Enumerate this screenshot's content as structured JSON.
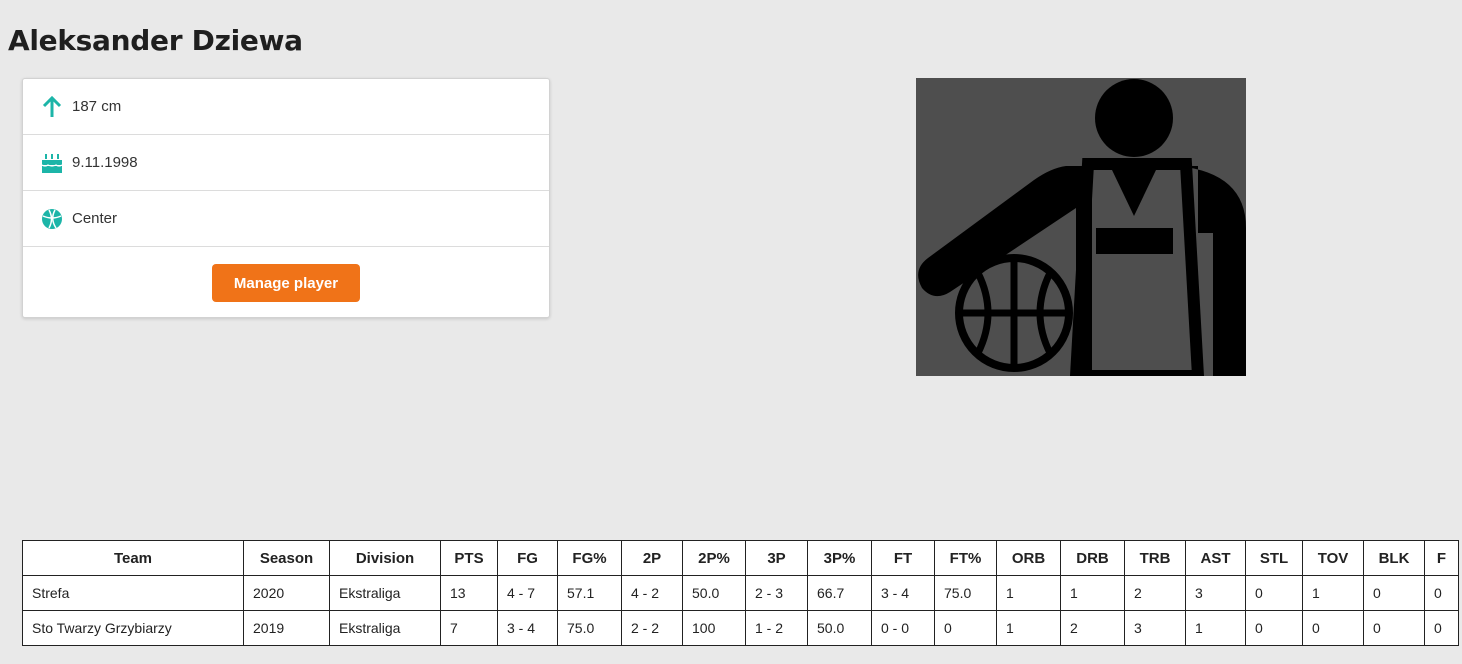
{
  "player": {
    "name": "Aleksander Dziewa"
  },
  "info": {
    "height": "187 cm",
    "birthdate": "9.11.1998",
    "position": "Center"
  },
  "actions": {
    "manage_label": "Manage player"
  },
  "icons": {
    "height": "arrow-up-icon",
    "birthdate": "birthday-cake-icon",
    "position": "basketball-icon",
    "photo": "basketball-player-placeholder"
  },
  "colors": {
    "accent": "#f07318",
    "icon": "#1cb5a8",
    "photo_bg": "#4e4e4e"
  },
  "stats": {
    "headers": [
      "Team",
      "Season",
      "Division",
      "PTS",
      "FG",
      "FG%",
      "2P",
      "2P%",
      "3P",
      "3P%",
      "FT",
      "FT%",
      "ORB",
      "DRB",
      "TRB",
      "AST",
      "STL",
      "TOV",
      "BLK",
      "F"
    ],
    "rows": [
      [
        "Strefa",
        "2020",
        "Ekstraliga",
        "13",
        "4 - 7",
        "57.1",
        "4 - 2",
        "50.0",
        "2 - 3",
        "66.7",
        "3 - 4",
        "75.0",
        "1",
        "1",
        "2",
        "3",
        "0",
        "1",
        "0",
        "0"
      ],
      [
        "Sto Twarzy Grzybiarzy",
        "2019",
        "Ekstraliga",
        "7",
        "3 - 4",
        "75.0",
        "2 - 2",
        "100",
        "1 - 2",
        "50.0",
        "0 - 0",
        "0",
        "1",
        "2",
        "3",
        "1",
        "0",
        "0",
        "0",
        "0"
      ]
    ]
  }
}
